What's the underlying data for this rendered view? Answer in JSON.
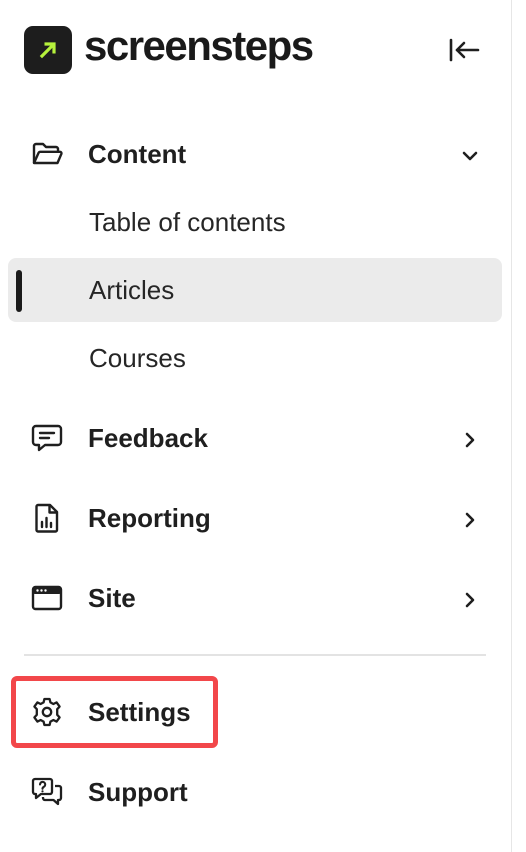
{
  "brand": {
    "name": "screensteps",
    "accent_color": "#b6f23c",
    "mark_color": "#1d1d1d"
  },
  "header": {
    "collapse_icon": "collapse-left-icon"
  },
  "nav": {
    "content": {
      "label": "Content",
      "icon": "folder-open-icon",
      "expanded": true,
      "items": [
        {
          "label": "Table of contents",
          "active": false
        },
        {
          "label": "Articles",
          "active": true
        },
        {
          "label": "Courses",
          "active": false
        }
      ]
    },
    "feedback": {
      "label": "Feedback",
      "icon": "message-icon"
    },
    "reporting": {
      "label": "Reporting",
      "icon": "report-file-icon"
    },
    "site": {
      "label": "Site",
      "icon": "browser-window-icon"
    },
    "settings": {
      "label": "Settings",
      "icon": "gear-icon",
      "highlighted": true,
      "highlight_color": "#f2474a"
    },
    "support": {
      "label": "Support",
      "icon": "help-chat-icon"
    }
  }
}
